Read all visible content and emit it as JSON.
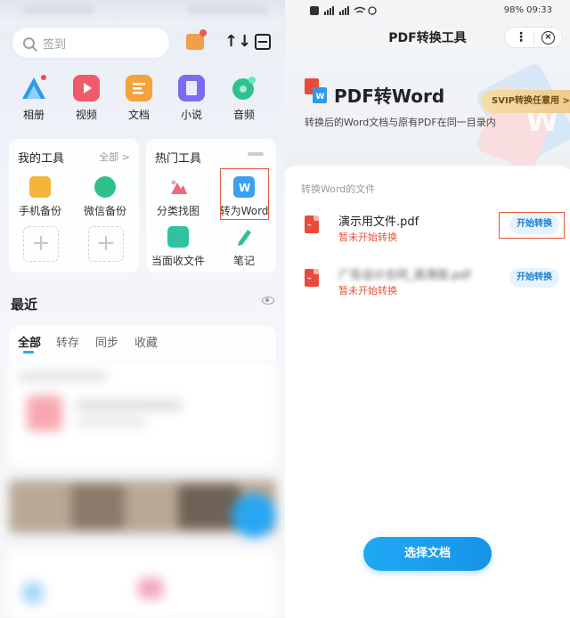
{
  "left": {
    "search_placeholder": "签到",
    "sort_icon": "↑↓",
    "apps": [
      {
        "label": "相册",
        "color": "#2f9ae8"
      },
      {
        "label": "视频",
        "color": "#f05a6a"
      },
      {
        "label": "文档",
        "color": "#f5a23a"
      },
      {
        "label": "小说",
        "color": "#7a6cf0"
      },
      {
        "label": "音频",
        "color": "#2dc28c"
      }
    ],
    "my_tools": {
      "title": "我的工具",
      "more": "全部 >",
      "items": [
        "手机备份",
        "微信备份"
      ],
      "plus": "+"
    },
    "hot_tools": {
      "title": "热门工具",
      "items": [
        "分类找图",
        "转为Word",
        "当面收文件",
        "笔记"
      ]
    },
    "recent": "最近",
    "tabs": [
      "全部",
      "转存",
      "同步",
      "收藏"
    ]
  },
  "right": {
    "status_right": "98%  09:33",
    "title": "PDF转换工具",
    "capsule_dots": "⋮",
    "capsule_close": "×",
    "hero_title": "PDF转Word",
    "hero_sub": "转换后的Word文档与原有PDF在同一目录内",
    "svip": "SVIP转换任意用 >",
    "section_label": "转换Word的文件",
    "files": [
      {
        "name": "演示用文件.pdf",
        "status": "暂未开始转换",
        "button": "开始转换"
      },
      {
        "name": "广告设计合同_高清版.pdf",
        "status": "暂未开始转换",
        "button": "开始转换"
      }
    ],
    "choose_button": "选择文档"
  }
}
